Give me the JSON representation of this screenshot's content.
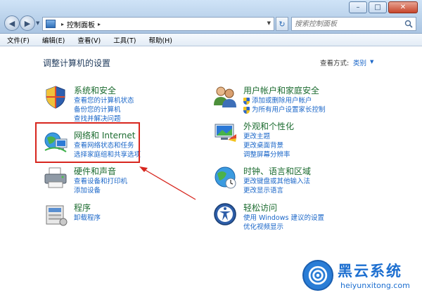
{
  "window": {
    "minimize_label": "–",
    "maximize_label": "□",
    "close_label": "✕"
  },
  "address_bar": {
    "separator": "▸",
    "path": "控制面板",
    "trailing_separator": "▸"
  },
  "search": {
    "placeholder": "搜索控制面板"
  },
  "menubar": {
    "items": [
      "文件(F)",
      "编辑(E)",
      "查看(V)",
      "工具(T)",
      "帮助(H)"
    ]
  },
  "content": {
    "heading": "调整计算机的设置",
    "view_by_label": "查看方式:",
    "view_by_value": "类别"
  },
  "categories": {
    "system_security": {
      "title": "系统和安全",
      "links": [
        "查看您的计算机状态",
        "备份您的计算机",
        "查找并解决问题"
      ]
    },
    "network": {
      "title": "网络和 Internet",
      "links": [
        "查看网络状态和任务",
        "选择家庭组和共享选项"
      ]
    },
    "hardware": {
      "title": "硬件和声音",
      "links": [
        "查看设备和打印机",
        "添加设备"
      ]
    },
    "programs": {
      "title": "程序",
      "links": [
        "卸载程序"
      ]
    },
    "user_accounts": {
      "title": "用户帐户和家庭安全",
      "links": [
        "添加或删除用户帐户",
        "为所有用户设置家长控制"
      ]
    },
    "appearance": {
      "title": "外观和个性化",
      "links": [
        "更改主题",
        "更改桌面背景",
        "调整屏幕分辨率"
      ]
    },
    "clock": {
      "title": "时钟、语言和区域",
      "links": [
        "更改键盘或其他输入法",
        "更改显示语言"
      ]
    },
    "ease": {
      "title": "轻松访问",
      "links": [
        "使用 Windows 建议的设置",
        "优化视频显示"
      ]
    }
  },
  "colors": {
    "category_title": "#1b6b2f",
    "link": "#1a66c8",
    "highlight": "#d7261e"
  },
  "watermark": {
    "title": "黑云系统",
    "url": "heiyunxitong.com"
  }
}
